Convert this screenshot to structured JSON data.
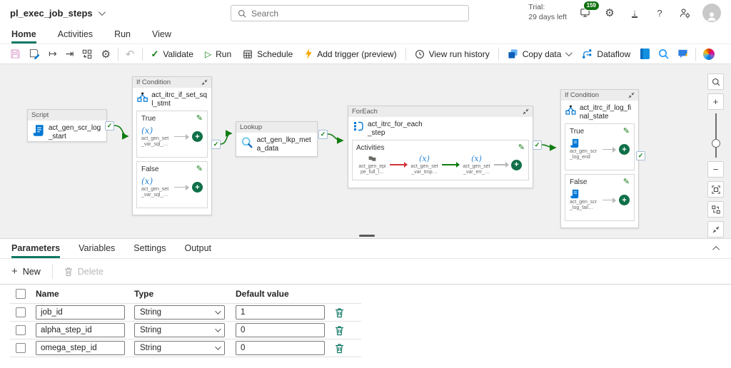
{
  "app": {
    "pipeline_name": "pl_exec_job_steps",
    "search_placeholder": "Search",
    "trial_label": "Trial:",
    "trial_days": "29 days left",
    "notification_count": "159",
    "help_glyph": "?"
  },
  "menu": {
    "tabs": [
      {
        "label": "Home",
        "active": true
      },
      {
        "label": "Activities",
        "active": false
      },
      {
        "label": "Run",
        "active": false
      },
      {
        "label": "View",
        "active": false
      }
    ]
  },
  "toolbar": {
    "validate_label": "Validate",
    "run_label": "Run",
    "schedule_label": "Schedule",
    "add_trigger_label": "Add trigger (preview)",
    "view_run_history_label": "View run history",
    "copy_data_label": "Copy data",
    "dataflow_label": "Dataflow"
  },
  "canvas": {
    "script": {
      "type_label": "Script",
      "name": "act_gen_scr_log_start"
    },
    "if_set_sql": {
      "type_label": "If Condition",
      "name": "act_itrc_if_set_sql_stmt",
      "true_label": "True",
      "false_label": "False",
      "true_activity": "act_gen_set_var_sql_…",
      "false_activity": "act_gen_set_var_sql_…"
    },
    "lookup": {
      "type_label": "Lookup",
      "name": "act_gen_lkp_meta_data"
    },
    "foreach": {
      "type_label": "ForEach",
      "name": "act_itrc_for_each_step",
      "activities_label": "Activities",
      "inner_activities": [
        "act_gen_epipe_full_l…",
        "act_gen_set_var_tmp…",
        "act_gen_set_var_err_…"
      ]
    },
    "if_log_final": {
      "type_label": "If Condition",
      "name": "act_itrc_if_log_final_state",
      "true_label": "True",
      "false_label": "False",
      "true_activity": "act_gen_scr_log_end",
      "false_activity": "act_gen_scr_log_fail…"
    }
  },
  "panel": {
    "tabs": [
      {
        "label": "Parameters",
        "active": true
      },
      {
        "label": "Variables",
        "active": false
      },
      {
        "label": "Settings",
        "active": false
      },
      {
        "label": "Output",
        "active": false
      }
    ],
    "new_label": "New",
    "delete_label": "Delete",
    "columns": {
      "name": "Name",
      "type": "Type",
      "default": "Default value"
    },
    "rows": [
      {
        "name": "job_id",
        "type": "String",
        "default": "1"
      },
      {
        "name": "alpha_step_id",
        "type": "String",
        "default": "0"
      },
      {
        "name": "omega_step_id",
        "type": "String",
        "default": "0"
      }
    ]
  },
  "icons": {
    "gear": "⚙",
    "undo": "↶",
    "validate_check": "✓",
    "run_play": "▷",
    "export_arrow": "↦",
    "import_arrow": "⇥",
    "download": "↓",
    "pencil": "✎",
    "variable": "(x)",
    "plus": "+",
    "minus": "−",
    "connector_check": "✓"
  },
  "colors": {
    "accent_green": "#117865",
    "node_blue": "#0078d4",
    "connector_green": "#107c10",
    "fail_red": "#d13438",
    "add_button_green": "#0f7048",
    "trash_teal": "#117865",
    "trial_badge": "#0e700e"
  }
}
